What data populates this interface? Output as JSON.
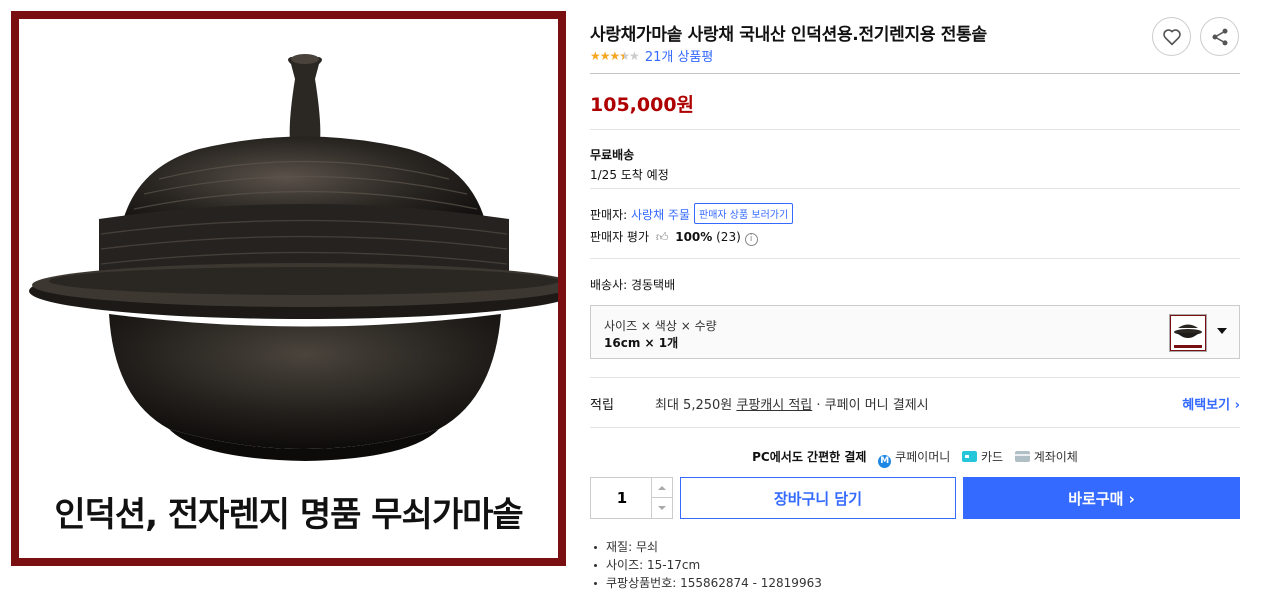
{
  "product": {
    "image_caption": "인덕션, 전자렌지 명품 무쇠가마솥",
    "title": "사랑채가마솥 사랑채 국내산 인덕션용.전기렌지용 전통솥",
    "rating": 3.5,
    "review_count_text": "21개 상품평",
    "price": "105,000원"
  },
  "shipping": {
    "type": "무료배송",
    "arrival": "1/25 도착 예정"
  },
  "seller": {
    "label": "판매자:",
    "name": "사랑채 주물",
    "view_products_tag": "판매자 상품 보러가기",
    "rating_label": "판매자 평가",
    "rating_percent": "100%",
    "rating_count": "(23)",
    "courier": "배송사: 경동택배"
  },
  "option": {
    "label": "사이즈 × 색상 × 수량",
    "value": "16cm × 1개"
  },
  "rewards": {
    "label": "적립",
    "text_prefix": "최대 5,250원 ",
    "text_link": "쿠팡캐시 적립",
    "text_suffix": " · 쿠페이 머니 결제시",
    "benefit_link": "혜택보기 ›"
  },
  "payment": {
    "heading": "PC에서도 간편한 결제",
    "coupay_label": "쿠페이머니",
    "coupay_glyph": "M",
    "card_label": "카드",
    "bank_label": "계좌이체"
  },
  "purchase": {
    "quantity": "1",
    "cart_label": "장바구니 담기",
    "buy_label": "바로구매 ›"
  },
  "details": [
    "재질: 무쇠",
    "사이즈: 15-17cm",
    "쿠팡상품번호: 155862874 - 12819963"
  ],
  "colors": {
    "accent": "#346aff",
    "price": "#ae0000",
    "star": "#f5a623",
    "image_frame": "#7a0f12"
  }
}
